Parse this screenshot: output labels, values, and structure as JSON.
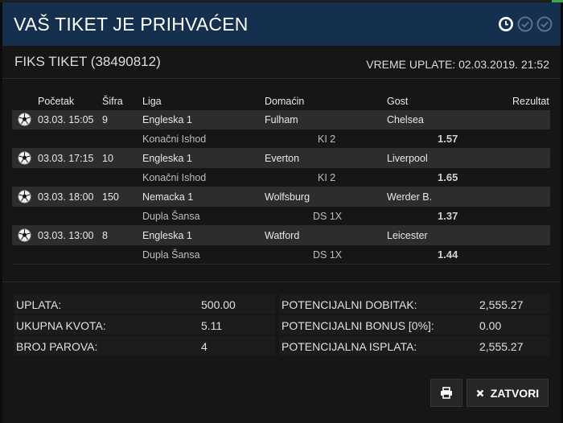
{
  "modal": {
    "title": "VAŠ TIKET JE PRIHVAĆEN",
    "ticket_title": "FIKS TIKET (38490812)",
    "payment_time": "VREME UPLATE: 02.03.2019. 21:52",
    "header_icons": [
      "clock-icon",
      "check-circle-icon",
      "check-circle-icon"
    ]
  },
  "table": {
    "headers": {
      "start": "Početak",
      "code": "Šifra",
      "league": "Liga",
      "home": "Domaćin",
      "away": "Gost",
      "result": "Rezultat"
    },
    "matches": [
      {
        "time": "03.03. 15:05",
        "code": "9",
        "league": "Engleska 1",
        "home": "Fulham",
        "away": "Chelsea",
        "bet_type": "Konačni Ishod",
        "pick": "KI 2",
        "odd": "1.57"
      },
      {
        "time": "03.03. 17:15",
        "code": "10",
        "league": "Engleska 1",
        "home": "Everton",
        "away": "Liverpool",
        "bet_type": "Konačni Ishod",
        "pick": "KI 2",
        "odd": "1.65"
      },
      {
        "time": "03.03. 18:00",
        "code": "150",
        "league": "Nemacka 1",
        "home": "Wolfsburg",
        "away": "Werder B.",
        "bet_type": "Dupla Šansa",
        "pick": "DS 1X",
        "odd": "1.37"
      },
      {
        "time": "03.03. 13:00",
        "code": "8",
        "league": "Engleska 1",
        "home": "Watford",
        "away": "Leicester",
        "bet_type": "Dupla Šansa",
        "pick": "DS 1X",
        "odd": "1.44"
      }
    ]
  },
  "summary": {
    "left": [
      {
        "label": "UPLATA:",
        "value": "500.00"
      },
      {
        "label": "UKUPNA KVOTA:",
        "value": "5.11"
      },
      {
        "label": "BROJ PAROVA:",
        "value": "4"
      }
    ],
    "right": [
      {
        "label": "POTENCIJALNI DOBITAK:",
        "value": "2,555.27"
      },
      {
        "label": "POTENCIJALNI BONUS [0%]:",
        "value": "0.00"
      },
      {
        "label": "POTENCIJALNA ISPLATA:",
        "value": "2,555.27"
      }
    ]
  },
  "buttons": {
    "print_icon": "printer-icon",
    "close_label": "ZATVORI",
    "close_icon": "close-icon"
  },
  "colors": {
    "header_bg": "#15304e",
    "modal_bg": "#161616",
    "row_bg": "#2d2d2d",
    "accent_green": "#3fa74a"
  }
}
